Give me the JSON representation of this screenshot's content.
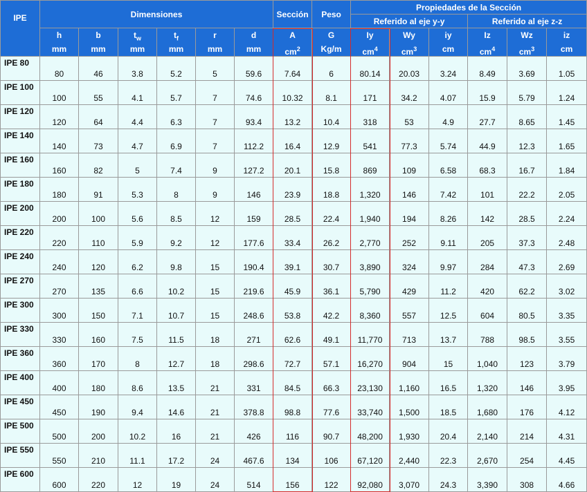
{
  "header": {
    "ipe_label": "IPE",
    "dimensiones": "Dimensiones",
    "seccion": "Sección",
    "peso": "Peso",
    "propiedades": "Propiedades de la Sección",
    "eje_y": "Referido al eje y-y",
    "eje_z": "Referido al eje z-z",
    "cols": [
      {
        "sym": "h",
        "sub": "",
        "unit": "mm",
        "unit_sup": ""
      },
      {
        "sym": "b",
        "sub": "",
        "unit": "mm",
        "unit_sup": ""
      },
      {
        "sym": "t",
        "sub": "w",
        "unit": "mm",
        "unit_sup": ""
      },
      {
        "sym": "t",
        "sub": "f",
        "unit": "mm",
        "unit_sup": ""
      },
      {
        "sym": "r",
        "sub": "",
        "unit": "mm",
        "unit_sup": ""
      },
      {
        "sym": "d",
        "sub": "",
        "unit": "mm",
        "unit_sup": ""
      },
      {
        "sym": "A",
        "sub": "",
        "unit": "cm",
        "unit_sup": "2"
      },
      {
        "sym": "G",
        "sub": "",
        "unit": "Kg/m",
        "unit_sup": ""
      },
      {
        "sym": "Iy",
        "sub": "",
        "unit": "cm",
        "unit_sup": "4"
      },
      {
        "sym": "Wy",
        "sub": "",
        "unit": "cm",
        "unit_sup": "3"
      },
      {
        "sym": "iy",
        "sub": "",
        "unit": "cm",
        "unit_sup": ""
      },
      {
        "sym": "Iz",
        "sub": "",
        "unit": "cm",
        "unit_sup": "4"
      },
      {
        "sym": "Wz",
        "sub": "",
        "unit": "cm",
        "unit_sup": "3"
      },
      {
        "sym": "iz",
        "sub": "",
        "unit": "cm",
        "unit_sup": ""
      }
    ]
  },
  "rows": [
    [
      "IPE 80",
      "80",
      "46",
      "3.8",
      "5.2",
      "5",
      "59.6",
      "7.64",
      "6",
      "80.14",
      "20.03",
      "3.24",
      "8.49",
      "3.69",
      "1.05"
    ],
    [
      "IPE 100",
      "100",
      "55",
      "4.1",
      "5.7",
      "7",
      "74.6",
      "10.32",
      "8.1",
      "171",
      "34.2",
      "4.07",
      "15.9",
      "5.79",
      "1.24"
    ],
    [
      "IPE 120",
      "120",
      "64",
      "4.4",
      "6.3",
      "7",
      "93.4",
      "13.2",
      "10.4",
      "318",
      "53",
      "4.9",
      "27.7",
      "8.65",
      "1.45"
    ],
    [
      "IPE 140",
      "140",
      "73",
      "4.7",
      "6.9",
      "7",
      "112.2",
      "16.4",
      "12.9",
      "541",
      "77.3",
      "5.74",
      "44.9",
      "12.3",
      "1.65"
    ],
    [
      "IPE 160",
      "160",
      "82",
      "5",
      "7.4",
      "9",
      "127.2",
      "20.1",
      "15.8",
      "869",
      "109",
      "6.58",
      "68.3",
      "16.7",
      "1.84"
    ],
    [
      "IPE 180",
      "180",
      "91",
      "5.3",
      "8",
      "9",
      "146",
      "23.9",
      "18.8",
      "1,320",
      "146",
      "7.42",
      "101",
      "22.2",
      "2.05"
    ],
    [
      "IPE 200",
      "200",
      "100",
      "5.6",
      "8.5",
      "12",
      "159",
      "28.5",
      "22.4",
      "1,940",
      "194",
      "8.26",
      "142",
      "28.5",
      "2.24"
    ],
    [
      "IPE 220",
      "220",
      "110",
      "5.9",
      "9.2",
      "12",
      "177.6",
      "33.4",
      "26.2",
      "2,770",
      "252",
      "9.11",
      "205",
      "37.3",
      "2.48"
    ],
    [
      "IPE 240",
      "240",
      "120",
      "6.2",
      "9.8",
      "15",
      "190.4",
      "39.1",
      "30.7",
      "3,890",
      "324",
      "9.97",
      "284",
      "47.3",
      "2.69"
    ],
    [
      "IPE 270",
      "270",
      "135",
      "6.6",
      "10.2",
      "15",
      "219.6",
      "45.9",
      "36.1",
      "5,790",
      "429",
      "11.2",
      "420",
      "62.2",
      "3.02"
    ],
    [
      "IPE 300",
      "300",
      "150",
      "7.1",
      "10.7",
      "15",
      "248.6",
      "53.8",
      "42.2",
      "8,360",
      "557",
      "12.5",
      "604",
      "80.5",
      "3.35"
    ],
    [
      "IPE 330",
      "330",
      "160",
      "7.5",
      "11.5",
      "18",
      "271",
      "62.6",
      "49.1",
      "11,770",
      "713",
      "13.7",
      "788",
      "98.5",
      "3.55"
    ],
    [
      "IPE 360",
      "360",
      "170",
      "8",
      "12.7",
      "18",
      "298.6",
      "72.7",
      "57.1",
      "16,270",
      "904",
      "15",
      "1,040",
      "123",
      "3.79"
    ],
    [
      "IPE 400",
      "400",
      "180",
      "8.6",
      "13.5",
      "21",
      "331",
      "84.5",
      "66.3",
      "23,130",
      "1,160",
      "16.5",
      "1,320",
      "146",
      "3.95"
    ],
    [
      "IPE 450",
      "450",
      "190",
      "9.4",
      "14.6",
      "21",
      "378.8",
      "98.8",
      "77.6",
      "33,740",
      "1,500",
      "18.5",
      "1,680",
      "176",
      "4.12"
    ],
    [
      "IPE 500",
      "500",
      "200",
      "10.2",
      "16",
      "21",
      "426",
      "116",
      "90.7",
      "48,200",
      "1,930",
      "20.4",
      "2,140",
      "214",
      "4.31"
    ],
    [
      "IPE 550",
      "550",
      "210",
      "11.1",
      "17.2",
      "24",
      "467.6",
      "134",
      "106",
      "67,120",
      "2,440",
      "22.3",
      "2,670",
      "254",
      "4.45"
    ],
    [
      "IPE 600",
      "600",
      "220",
      "12",
      "19",
      "24",
      "514",
      "156",
      "122",
      "92,080",
      "3,070",
      "24.3",
      "3,390",
      "308",
      "4.66"
    ]
  ],
  "colors": {
    "header_bg": "#1e6dd6",
    "cell_bg": "#e8fbfb",
    "highlight_border": "#d42a2a"
  }
}
